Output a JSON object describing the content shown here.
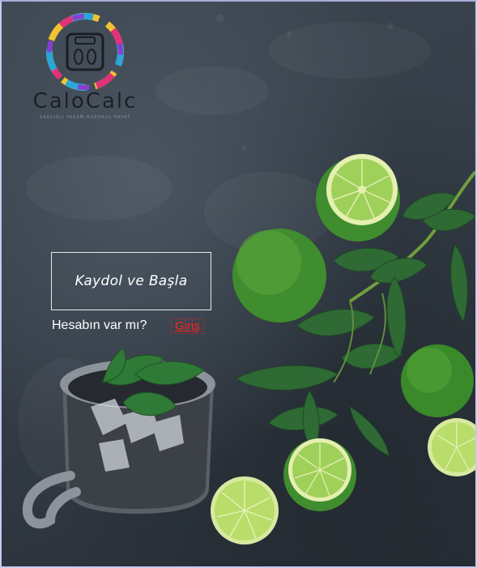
{
  "brand": {
    "name": "CaloCalc",
    "tagline": "SAĞLIKLI YAŞAM HUZURLU HAYAT"
  },
  "signup": {
    "label": "Kaydol ve Başla"
  },
  "login": {
    "question": "Hesabın var mı?",
    "link_label": "Giriş"
  },
  "colors": {
    "background": "#353e48",
    "button_border": "#e9eaec",
    "link": "#ff2020",
    "lime": "#74b43a",
    "mint": "#3f7a3c"
  },
  "icons": {
    "logo": "scale-icon"
  }
}
